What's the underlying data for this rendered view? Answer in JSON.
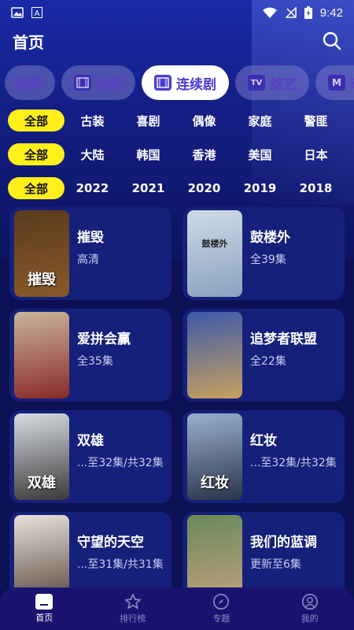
{
  "statusbar": {
    "time": "9:42"
  },
  "header": {
    "title": "首页"
  },
  "categories": [
    {
      "label": "推荐",
      "icon": "none"
    },
    {
      "label": "电影",
      "icon": "film-icon"
    },
    {
      "label": "连续剧",
      "icon": "film-icon",
      "active": true
    },
    {
      "label": "综艺",
      "icon": "tv-icon"
    },
    {
      "label": "动",
      "icon": "m-icon"
    }
  ],
  "filters": {
    "genre": [
      "全部",
      "古装",
      "喜剧",
      "偶像",
      "家庭",
      "警匪"
    ],
    "region": [
      "全部",
      "大陆",
      "韩国",
      "香港",
      "美国",
      "日本"
    ],
    "year": [
      "全部",
      "2022",
      "2021",
      "2020",
      "2019",
      "2018"
    ]
  },
  "shows": [
    {
      "title": "摧毁",
      "subtitle": "高清",
      "poster_text": "摧毁",
      "poster_colors": [
        "#5a3a1e",
        "#8a5a2a"
      ]
    },
    {
      "title": "鼓楼外",
      "subtitle": "全39集",
      "poster_text": "鼓楼外",
      "poster_colors": [
        "#cfd9e6",
        "#8aa3c0"
      ]
    },
    {
      "title": "爱拼会赢",
      "subtitle": "全35集",
      "poster_text": "",
      "poster_colors": [
        "#c9b59a",
        "#8a2a2a"
      ]
    },
    {
      "title": "追梦者联盟",
      "subtitle": "全22集",
      "poster_text": "",
      "poster_colors": [
        "#3c5aa8",
        "#c8a060"
      ]
    },
    {
      "title": "双雄",
      "subtitle": "...至32集/共32集",
      "poster_text": "双雄",
      "poster_colors": [
        "#d8dce2",
        "#3a3a3a"
      ]
    },
    {
      "title": "红妆",
      "subtitle": "...至32集/共32集",
      "poster_text": "红妆",
      "poster_colors": [
        "#9ab0d0",
        "#2a3448"
      ]
    },
    {
      "title": "守望的天空",
      "subtitle": "...至31集/共31集",
      "poster_text": "",
      "poster_colors": [
        "#e8e2da",
        "#5a4a40"
      ]
    },
    {
      "title": "我们的蓝调",
      "subtitle": "更新至6集",
      "poster_text": "",
      "poster_colors": [
        "#6a8a5a",
        "#c0a080"
      ]
    }
  ],
  "bottomnav": [
    {
      "label": "首页",
      "active": true
    },
    {
      "label": "排行榜"
    },
    {
      "label": "专题"
    },
    {
      "label": "我的"
    }
  ],
  "colors": {
    "accent_yellow": "#ffef1a",
    "bg": "#0c1156",
    "card": "#15207a"
  }
}
